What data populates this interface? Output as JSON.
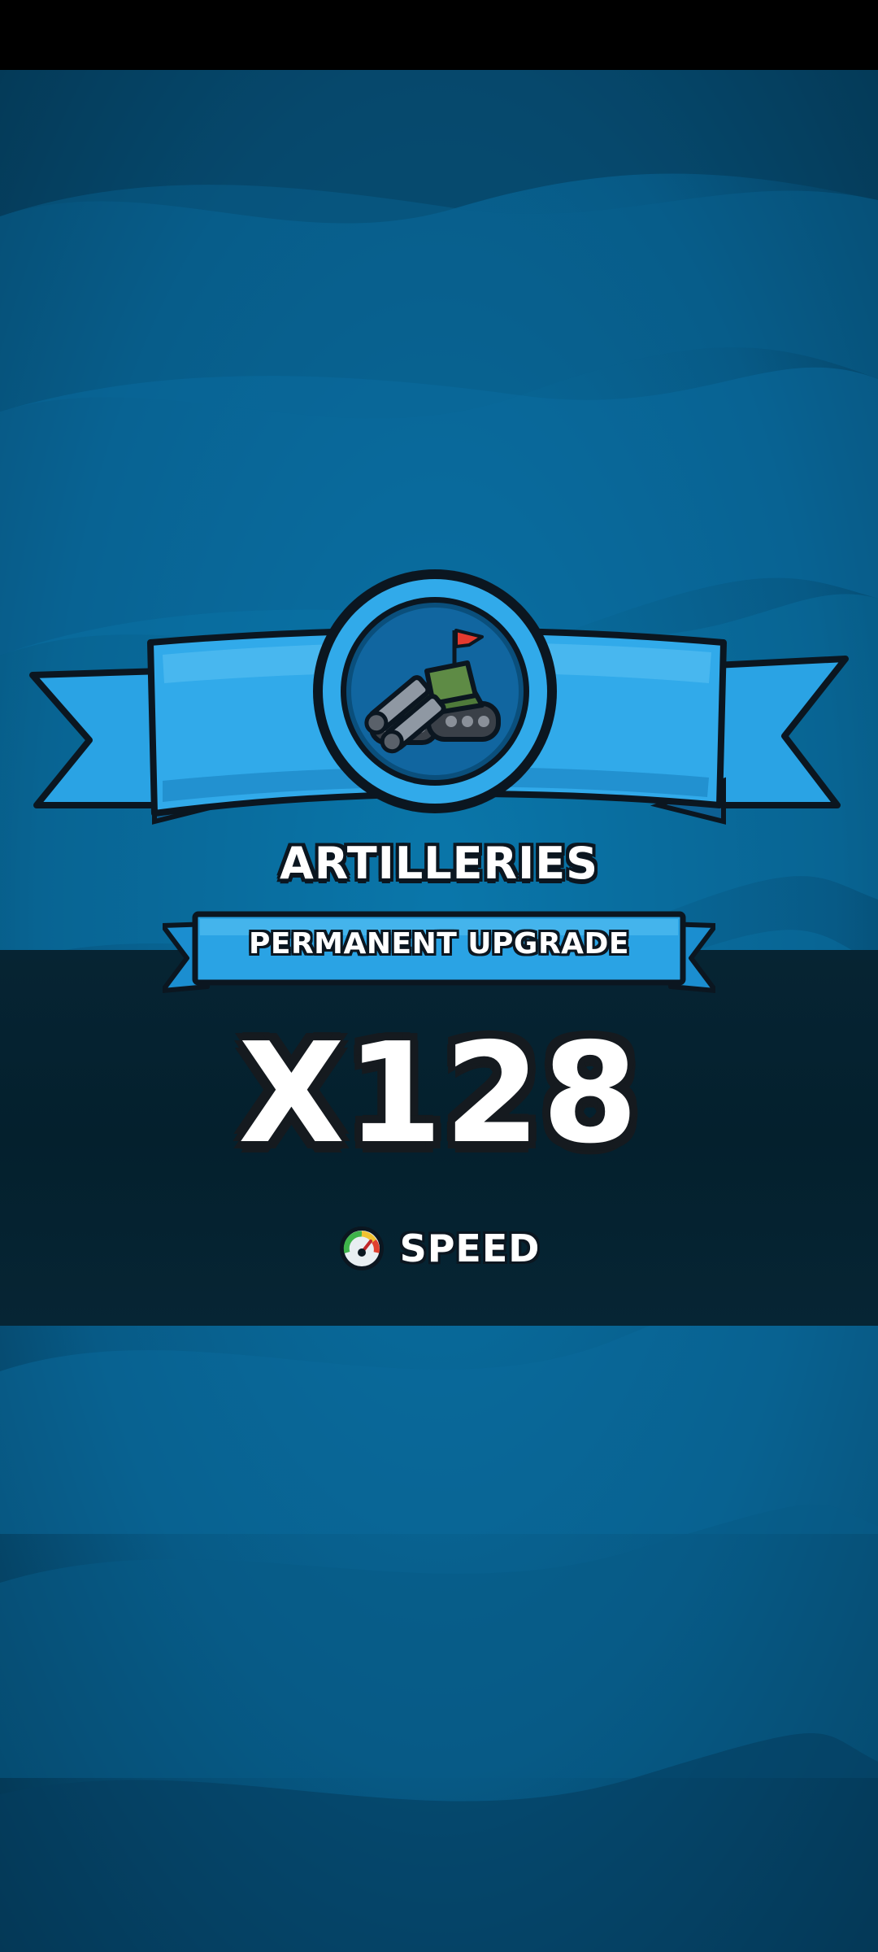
{
  "reward": {
    "title": "ARTILLERIES",
    "subtitle": "PERMANENT UPGRADE",
    "multiplier": "X128",
    "stat_label": "SPEED",
    "unit_icon": "artillery-tank-icon",
    "stat_icon": "speedometer-icon"
  },
  "colors": {
    "background_top": "#064d72",
    "background_mid": "#0a6b9c",
    "ribbon": "#2aa3e4",
    "ribbon_dark": "#1277b4",
    "outline": "#0b1620",
    "band": "#04202d",
    "text": "#ffffff"
  }
}
